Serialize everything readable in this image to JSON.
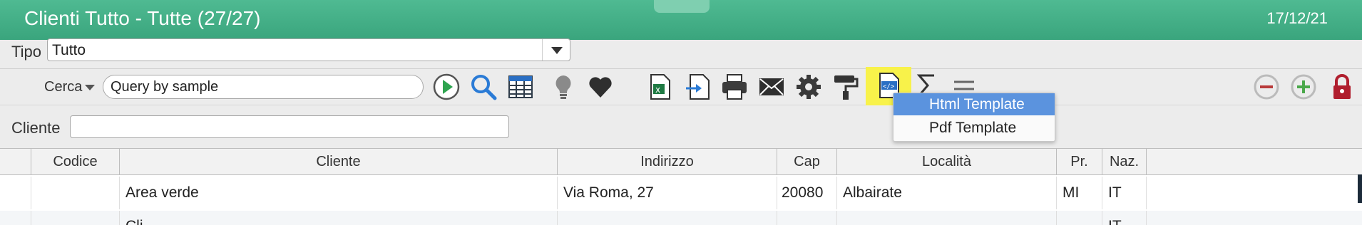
{
  "window": {
    "title": "Clienti Tutto - Tutte (27/27)",
    "date": "17/12/21"
  },
  "filter": {
    "tipo_label": "Tipo",
    "tipo_value": "Tutto"
  },
  "search": {
    "label": "Cerca",
    "value": "Query by sample"
  },
  "cliente_filter": {
    "label": "Cliente",
    "value": ""
  },
  "menu": {
    "items": [
      "Html Template",
      "Pdf Template"
    ],
    "selected": "Html Template"
  },
  "columns": [
    "",
    "Codice",
    "Cliente",
    "Indirizzo",
    "Cap",
    "Località",
    "Pr.",
    "Naz."
  ],
  "rows": [
    [
      "",
      "",
      "Area verde",
      "Via Roma, 27",
      "20080",
      "Albairate",
      "MI",
      "IT"
    ],
    [
      "",
      "",
      "Cli...",
      "",
      "",
      "",
      "",
      "IT"
    ]
  ],
  "colors": {
    "title_bar": "#3aa57d",
    "highlight": "#f8f24a",
    "menu_selected": "#5b93de"
  }
}
